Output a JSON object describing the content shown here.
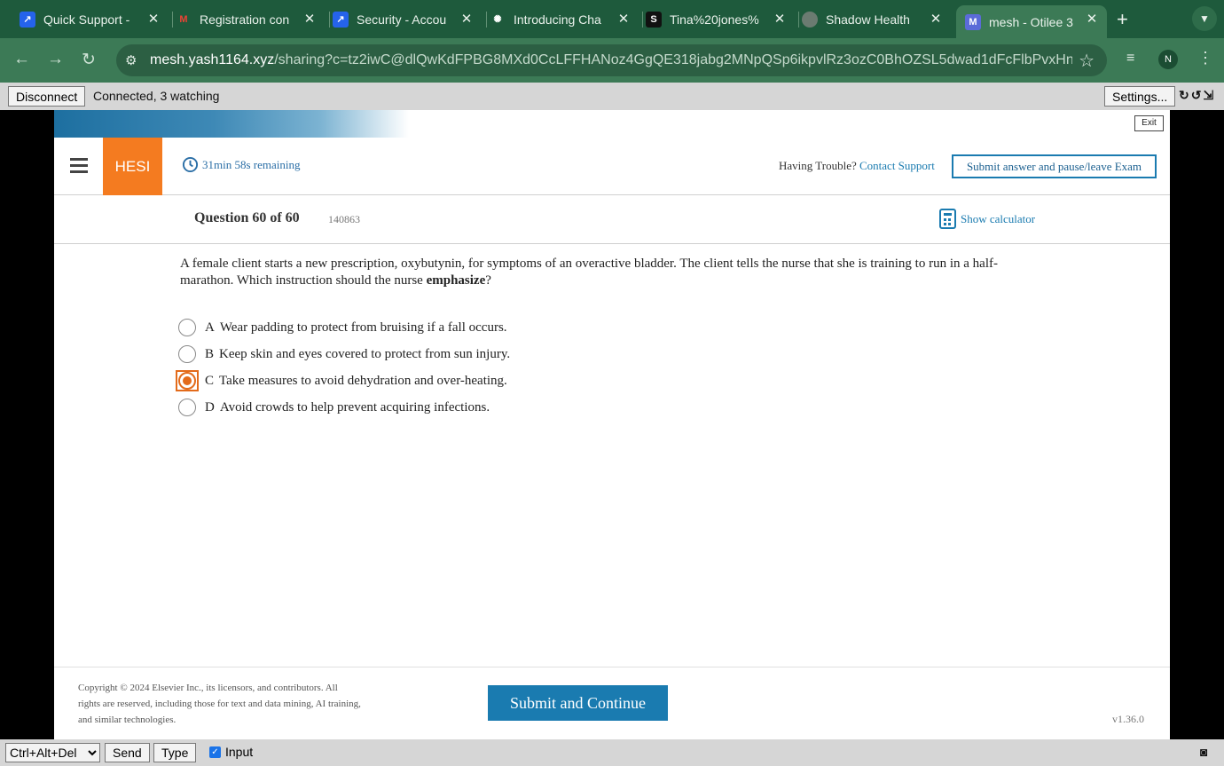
{
  "browser": {
    "tabs": [
      {
        "title": "Quick Support -",
        "favicon": "Q",
        "favicon_color": "#2563eb"
      },
      {
        "title": "Registration con",
        "favicon": "M",
        "favicon_color": "#ea4335"
      },
      {
        "title": "Security - Accou",
        "favicon": "S",
        "favicon_color": "#2563eb"
      },
      {
        "title": "Introducing Cha",
        "favicon": "O",
        "favicon_color": "#111111"
      },
      {
        "title": "Tina%20jones%",
        "favicon": "S",
        "favicon_color": "#111111"
      },
      {
        "title": "Shadow Health",
        "favicon": "G",
        "favicon_color": "#6b7b71"
      },
      {
        "title": "mesh - Otilee 3",
        "favicon": "M",
        "favicon_color": "#5b6bd8"
      }
    ],
    "url_host": "mesh.yash1164.xyz",
    "url_path": "/sharing?c=tz2iwC@dlQwKdFPBG8MXd0CcLFFHANoz4GgQE318jabg2MNpQSp6ikpvlRz3ozC0BhOZSL5dwad1dFcFlbPvxHn...",
    "profile_initial": "N"
  },
  "connection": {
    "disconnect_label": "Disconnect",
    "status": "Connected, 3 watching",
    "settings_label": "Settings..."
  },
  "exam": {
    "exit_label": "Exit",
    "logo": "HESI",
    "timer": "31min 58s remaining",
    "trouble_text": "Having Trouble?",
    "contact_link": "Contact Support",
    "submit_pause_label": "Submit answer and pause/leave Exam",
    "question_number": "Question 60 of 60",
    "question_id": "140863",
    "calculator_label": "Show calculator",
    "stem_part1": "A female client starts a new prescription, oxybutynin, for symptoms of an overactive bladder. The client tells the nurse that she is training to run in a half-marathon. Which instruction should the nurse ",
    "stem_emphasis": "emphasize",
    "stem_end": "?",
    "options": [
      {
        "letter": "A",
        "text": "Wear padding to protect from bruising if a fall occurs.",
        "selected": false
      },
      {
        "letter": "B",
        "text": "Keep skin and eyes covered to protect from sun injury.",
        "selected": false
      },
      {
        "letter": "C",
        "text": "Take measures to avoid dehydration and over-heating.",
        "selected": true
      },
      {
        "letter": "D",
        "text": "Avoid crowds to help prevent acquiring infections.",
        "selected": false
      }
    ],
    "copyright": "Copyright © 2024 Elsevier Inc., its licensors, and contributors. All rights are reserved, including those for text and data mining, AI training, and similar technologies.",
    "submit_continue_label": "Submit and Continue",
    "version": "v1.36.0",
    "accent_color": "#f47b20",
    "link_color": "#1a7bb0"
  },
  "bottom": {
    "key_combo": "Ctrl+Alt+Del",
    "send_label": "Send",
    "type_label": "Type",
    "input_label": "Input",
    "input_checked": true
  }
}
